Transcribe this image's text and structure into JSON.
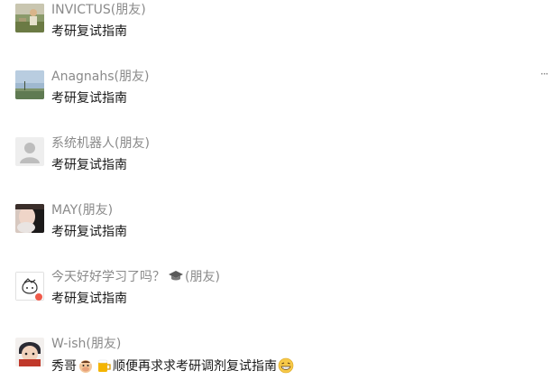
{
  "messages": [
    {
      "name": "INVICTUS(朋友)",
      "text": "考研复试指南",
      "avatar_icon": "avatar-person-outdoor"
    },
    {
      "name": "Anagnahs(朋友)",
      "text": "考研复试指南",
      "avatar_icon": "avatar-sky-field"
    },
    {
      "name": "系统机器人(朋友)",
      "text": "考研复试指南",
      "avatar_icon": "avatar-default-gray"
    },
    {
      "name": "MAY(朋友)",
      "text": "考研复试指南",
      "avatar_icon": "avatar-girl-photo"
    },
    {
      "name_part1": "今天好好学习了吗？",
      "name_part2": "(朋友)",
      "text": "考研复试指南",
      "avatar_icon": "avatar-sketch-drawing",
      "name_icon": "graduation-cap-icon"
    },
    {
      "name": "W-ish(朋友)",
      "text_part1": "秀哥",
      "text_part2": "顺便再求求考研调剂复试指南",
      "avatar_icon": "avatar-anime-character",
      "emojis": [
        "cow-face-emoji",
        "beer-emoji",
        "grin-emoji"
      ]
    }
  ],
  "more_icon": "more-dots-icon",
  "colors": {
    "name": "#8a8a8a",
    "text": "#191919",
    "background": "#ffffff"
  }
}
